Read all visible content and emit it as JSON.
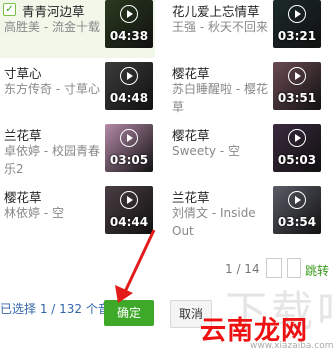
{
  "videos": [
    {
      "title": "青青河边草",
      "artist": "高胜美 - 流金十载",
      "duration": "04:38",
      "selected": true,
      "thumb": "#2a3a1e"
    },
    {
      "title": "花儿爱上忘情草",
      "artist": "王强 - 秋天不回来",
      "duration": "03:21",
      "selected": false,
      "thumb": "#1c2a2a"
    },
    {
      "title": "寸草心",
      "artist": "东方传奇 - 寸草心",
      "duration": "04:48",
      "selected": false,
      "thumb": "#3b3b3b"
    },
    {
      "title": "樱花草",
      "artist": "苏白睡醒啦 - 樱花草",
      "duration": "03:51",
      "selected": false,
      "thumb": "#6a4a52"
    },
    {
      "title": "兰花草",
      "artist": "卓依婷 - 校园青春乐2",
      "duration": "03:05",
      "selected": false,
      "thumb": "#b48aa8"
    },
    {
      "title": "樱花草",
      "artist": "Sweety - 空",
      "duration": "05:03",
      "selected": false,
      "thumb": "#3a2a3e"
    },
    {
      "title": "樱花草",
      "artist": "林依婷 - 空",
      "duration": "04:44",
      "selected": false,
      "thumb": "#4a3e44"
    },
    {
      "title": "兰花草",
      "artist": "刘倩文 - Inside Out",
      "duration": "03:54",
      "selected": false,
      "thumb": "#5a5c66"
    }
  ],
  "pager": {
    "page_text": "1 / 14",
    "jump_label": "跳转"
  },
  "footer": {
    "status": "已选择 1 / 132 个音视",
    "ok_label": "确定",
    "cancel_label": "取消"
  },
  "watermark": {
    "text": "云南龙网",
    "ghost": "下载吧",
    "url": "www.xiazaiba.com"
  },
  "colors": {
    "accent": "#3ea828",
    "arrow": "#e31b1b"
  }
}
